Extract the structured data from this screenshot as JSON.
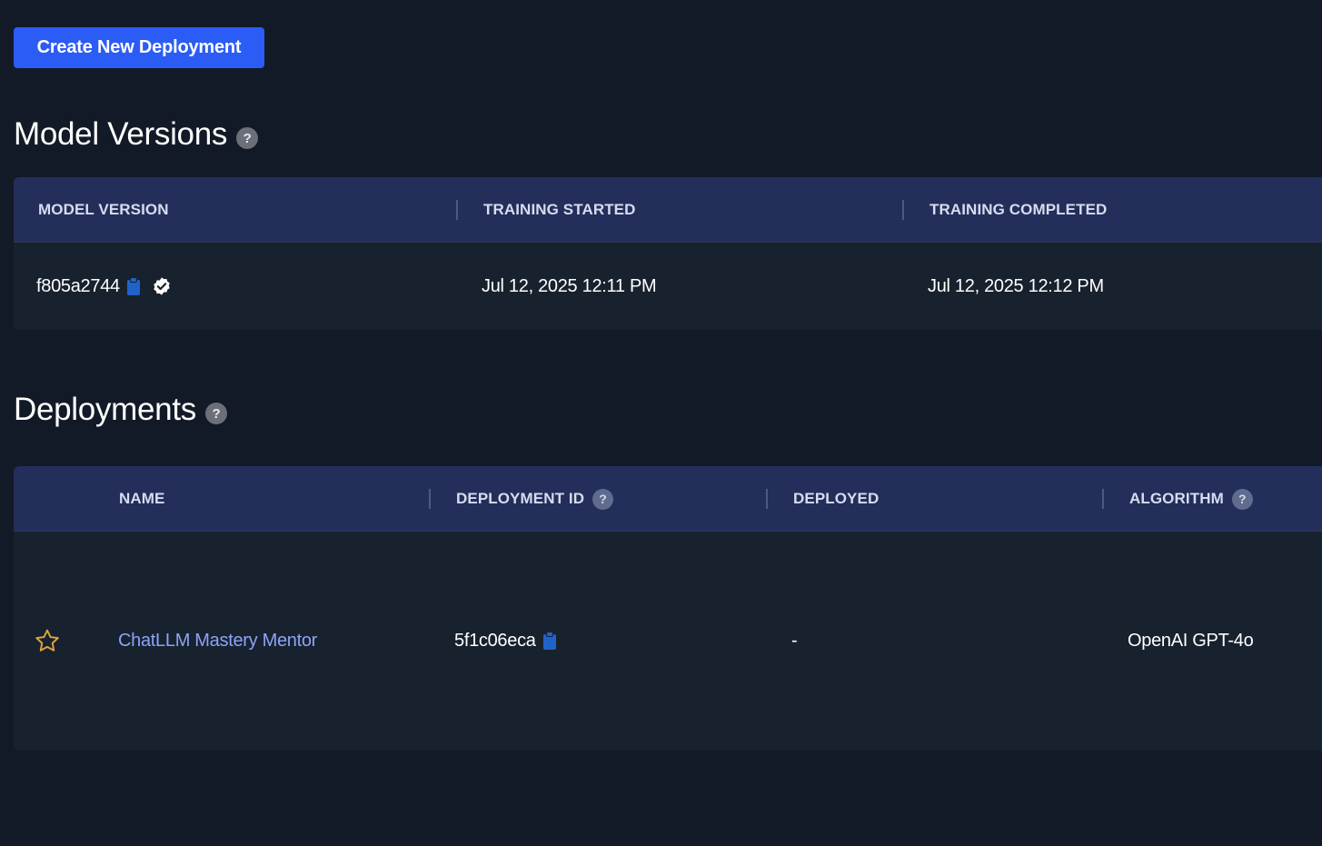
{
  "toolbar": {
    "create_label": "Create New Deployment"
  },
  "model_versions": {
    "title": "Model Versions",
    "help": "?",
    "columns": [
      "MODEL VERSION",
      "TRAINING STARTED",
      "TRAINING COMPLETED"
    ],
    "rows": [
      {
        "version": "f805a2744",
        "training_started": "Jul 12, 2025 12:11 PM",
        "training_completed": "Jul 12, 2025 12:12 PM"
      }
    ]
  },
  "deployments": {
    "title": "Deployments",
    "help": "?",
    "columns": [
      "NAME",
      "DEPLOYMENT ID",
      "DEPLOYED",
      "ALGORITHM"
    ],
    "column_help": "?",
    "rows": [
      {
        "name": "ChatLLM Mastery Mentor",
        "deployment_id": "5f1c06eca",
        "deployed": "-",
        "algorithm": "OpenAI GPT-4o"
      }
    ]
  },
  "icons": {
    "copy": "clipboard-icon",
    "verified": "verified-check-icon",
    "favorite": "star-icon",
    "help": "help-circle-icon"
  },
  "colors": {
    "background": "#131a27",
    "accent": "#2b5cf5",
    "table_header": "#232e5a",
    "table_body": "#18212e",
    "link": "#8aa4f8",
    "star": "#e0a33a",
    "clipboard": "#1f63c9"
  }
}
